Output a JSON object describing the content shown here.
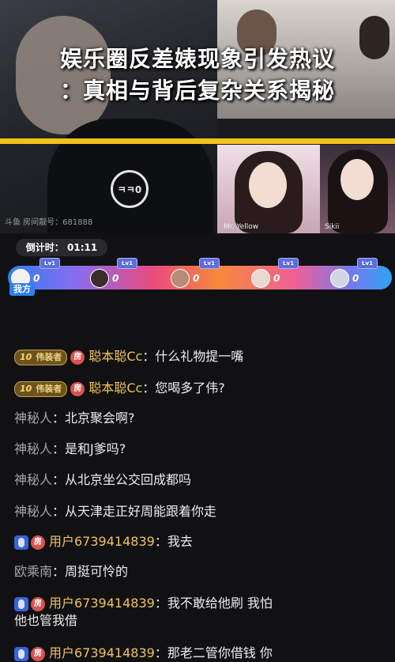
{
  "headline": {
    "line1": "娱乐圈反差婊现象引发热议",
    "line2": "：真相与背后复杂关系揭秘"
  },
  "stream": {
    "host_logo_text": "ㅋㅋ0",
    "host_room_text": "斗鱼 房间靓号：681888",
    "guest1_label": "Mr. Yellow",
    "guest2_label": "Sikii"
  },
  "pk": {
    "countdown_label": "倒计时：",
    "countdown_value": "01:11",
    "mine_label": "我方",
    "slots": [
      {
        "score": "0",
        "badge": "Lv1"
      },
      {
        "score": "0",
        "badge": "Lv1"
      },
      {
        "score": "0",
        "badge": "Lv1"
      },
      {
        "score": "0",
        "badge": "Lv1"
      },
      {
        "score": "0",
        "badge": "Lv1"
      }
    ]
  },
  "chat": [
    {
      "level": "10",
      "title": "伟装者",
      "room": "房",
      "name": "聪本聪Cc",
      "text": "：什么礼物提一嘴",
      "type": "vip"
    },
    {
      "level": "10",
      "title": "伟装者",
      "room": "房",
      "name": "聪本聪Cc",
      "text": "：您喝多了伟?",
      "type": "vip"
    },
    {
      "name": "神秘人",
      "text": "：北京聚会啊?",
      "type": "plain"
    },
    {
      "name": "神秘人",
      "text": "：是和J爹吗?",
      "type": "plain"
    },
    {
      "name": "神秘人",
      "text": "：从北京坐公交回成都吗",
      "type": "plain"
    },
    {
      "name": "神秘人",
      "text": "：从天津走正好周能跟着你走",
      "type": "plain"
    },
    {
      "room": "房",
      "name": "用户6739414839",
      "text": "：我去",
      "type": "user"
    },
    {
      "name": "欧乘南",
      "text": "：周挺可怜的",
      "type": "plain"
    },
    {
      "room": "房",
      "name": "用户6739414839",
      "text": "：我不敢给他刷 我怕",
      "text2": "他也管我借",
      "type": "user"
    },
    {
      "room": "房",
      "name": "用户6739414839",
      "text": "：那老二管你借钱 你",
      "type": "user"
    }
  ]
}
